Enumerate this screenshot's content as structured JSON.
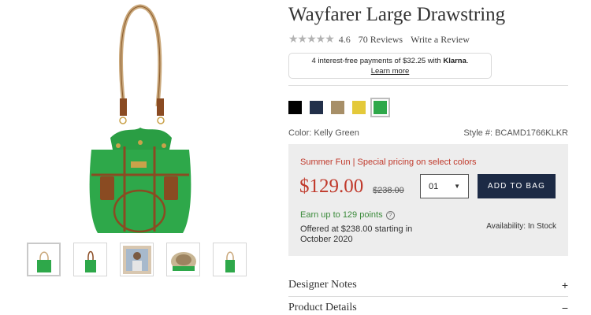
{
  "product": {
    "title": "Wayfarer Large Drawstring",
    "rating": "4.6",
    "reviews_label": "70 Reviews",
    "write_review_label": "Write a Review"
  },
  "klarna": {
    "line1_prefix": "4 interest-free payments of $32.25 with ",
    "brand": "Klarna",
    "line1_suffix": ".",
    "learn_more": "Learn more"
  },
  "swatches": [
    {
      "name": "Black",
      "color": "#000000"
    },
    {
      "name": "Navy",
      "color": "#22304a"
    },
    {
      "name": "Taupe",
      "color": "#a78f68"
    },
    {
      "name": "Yellow",
      "color": "#e4c93a"
    },
    {
      "name": "Kelly Green",
      "color": "#2ea84a"
    }
  ],
  "selection": {
    "color_label": "Color: Kelly Green",
    "style_label": "Style #: BCAMD1766KLKR"
  },
  "purchase": {
    "promo": "Summer Fun | Special pricing on select colors",
    "price": "$129.00",
    "original_price": "$238.00",
    "quantity": "01",
    "add_to_bag": "ADD TO BAG",
    "points": "Earn up to 129 points",
    "offered": "Offered at $238.00 starting in October 2020",
    "availability": "Availability: In Stock"
  },
  "accordion": [
    {
      "label": "Designer Notes",
      "sign": "+"
    },
    {
      "label": "Product Details",
      "sign": "−"
    }
  ],
  "colors": {
    "sale_red": "#c0392b",
    "button_navy": "#1c2a45",
    "points_green": "#3a8a3a",
    "bag_green": "#2ea84a"
  }
}
